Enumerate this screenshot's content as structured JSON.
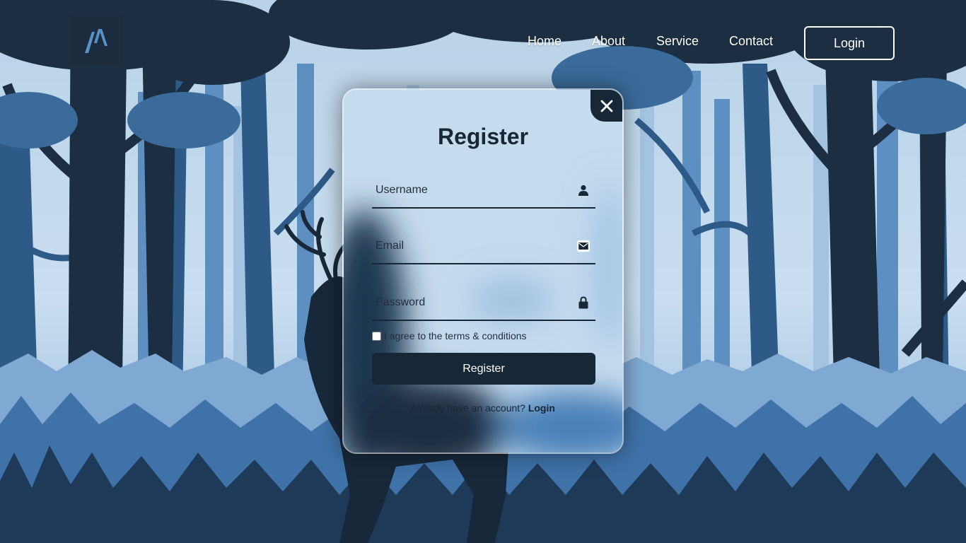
{
  "nav": {
    "links": [
      "Home",
      "About",
      "Service",
      "Contact"
    ],
    "login_label": "Login"
  },
  "form": {
    "title": "Register",
    "username_placeholder": "Username",
    "email_placeholder": "Email",
    "password_placeholder": "Password",
    "terms_label": "I agree to the terms & conditions",
    "terms_checked": false,
    "submit_label": "Register",
    "switch_text": "Already have an account?",
    "switch_link": "Login"
  },
  "icons": {
    "close": "close-icon",
    "username": "person-icon",
    "email": "mail-icon",
    "password": "lock-icon",
    "logo": "brand-logo"
  },
  "colors": {
    "dark": "#162738",
    "sky": "#c4dbed",
    "white": "#ffffff"
  }
}
